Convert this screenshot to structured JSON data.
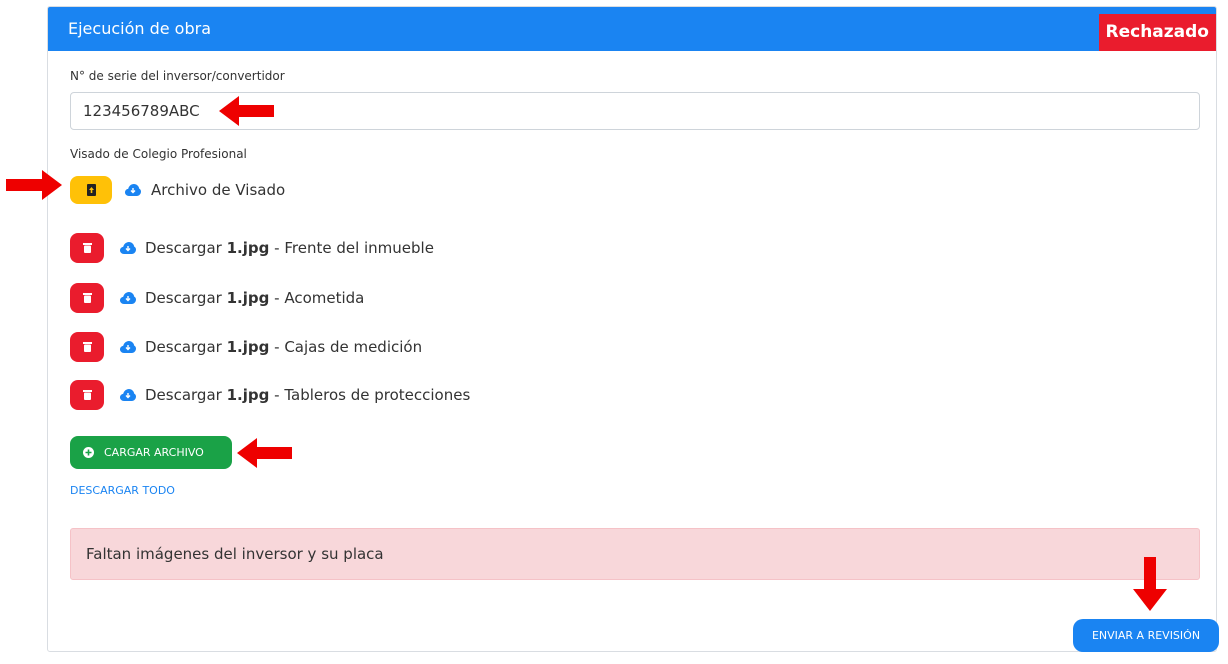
{
  "header": {
    "title": "Ejecución de obra",
    "status": "Rechazado",
    "accent_color": "#1a84f2",
    "status_color": "#ea1c2d"
  },
  "serial": {
    "label": "N° de serie del inversor/convertidor",
    "value": "123456789ABC"
  },
  "visado": {
    "label": "Visado de Colegio Profesional",
    "file_label": "Archivo de Visado",
    "upload_icon": "upload-icon",
    "cloud_icon": "cloud-download-icon"
  },
  "files": [
    {
      "prefix": "Descargar",
      "filename": "1.jpg",
      "description": "- Frente del inmueble"
    },
    {
      "prefix": "Descargar",
      "filename": "1.jpg",
      "description": "- Acometida"
    },
    {
      "prefix": "Descargar",
      "filename": "1.jpg",
      "description": "- Cajas de medición"
    },
    {
      "prefix": "Descargar",
      "filename": "1.jpg",
      "description": "- Tableros de protecciones"
    }
  ],
  "actions": {
    "load_file": "CARGAR ARCHIVO",
    "download_all": "DESCARGAR TODO",
    "send_review": "ENVIAR A REVISIÓN"
  },
  "alert": {
    "message": "Faltan imágenes del inversor y su placa"
  }
}
